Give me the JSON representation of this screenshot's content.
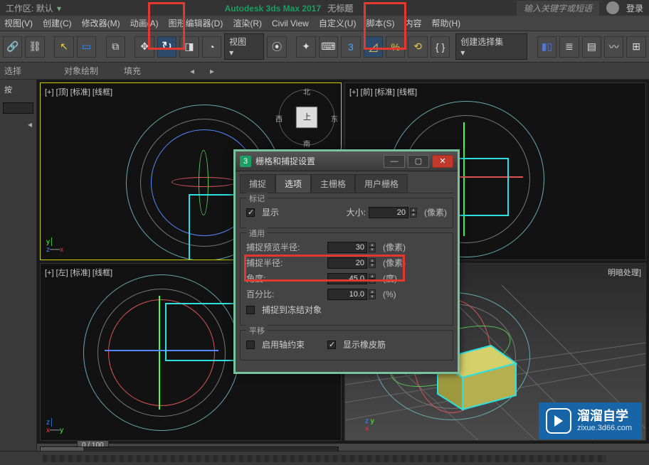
{
  "topbar": {
    "workspace_prefix": "工作区:",
    "workspace_value": "默认",
    "app_title": "Autodesk 3ds Max 2017",
    "doc_name": "无标题",
    "search_placeholder": "输入关键字或短语",
    "sign_in": "登录"
  },
  "menus": [
    "视图(V)",
    "创建(C)",
    "修改器(M)",
    "动画(A)",
    "图形编辑器(D)",
    "渲染(R)",
    "Civil View",
    "自定义(U)",
    "脚本(S)",
    "内容",
    "帮助(H)"
  ],
  "toolbar": {
    "view_dd": "视图",
    "selset_dd": "创建选择集"
  },
  "subbar": {
    "select": "选择",
    "objpaint": "对象绘制",
    "fill": "填充"
  },
  "viewport": {
    "top": "[+] [顶] [标准] [线框]",
    "front": "[+] [前] [标准] [线框]",
    "left": "[+] [左] [标准] [线框]",
    "persp": "明暗处理]"
  },
  "dialog": {
    "title": "栅格和捕捉设置",
    "tabs": [
      "捕捉",
      "选项",
      "主栅格",
      "用户栅格"
    ],
    "active_tab": 1,
    "marker_group": "标记",
    "display_label": "显示",
    "size_label": "大小:",
    "size_value": "20",
    "general_group": "通用",
    "preview_radius_label": "捕捉预览半径:",
    "preview_radius_value": "30",
    "snap_radius_label": "捕捉半径:",
    "snap_radius_value": "20",
    "angle_label": "角度:",
    "angle_value": "45.0",
    "angle_unit": "(度)",
    "percent_label": "百分比:",
    "percent_value": "10.0",
    "percent_unit": "(%)",
    "px_unit": "(像素)",
    "snap_frozen": "捕捉到冻结对象",
    "translate_group": "平移",
    "axis_constraint": "启用轴约束",
    "rubber_band": "显示橡皮筋"
  },
  "timeline": {
    "frame": "0 / 100"
  },
  "watermark": {
    "cn": "溜溜自学",
    "url": "zixue.3d66.com"
  },
  "viewcube": {
    "center": "上",
    "n": "北",
    "s": "南",
    "w": "西",
    "e": "东"
  }
}
